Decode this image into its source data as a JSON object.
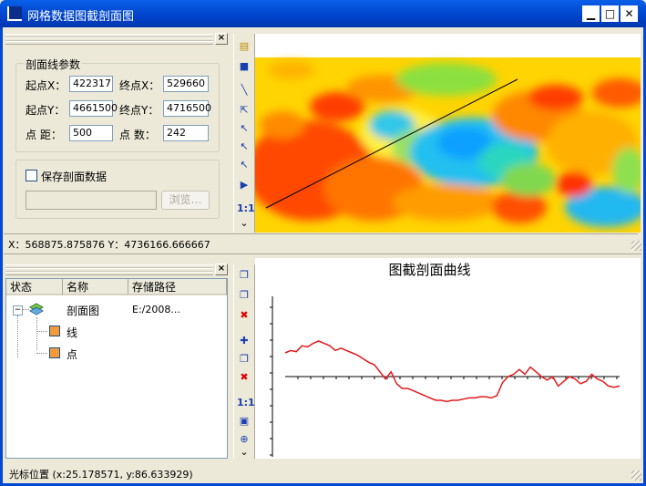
{
  "window": {
    "title": "网格数据图截剖面图"
  },
  "params": {
    "group_title": "剖面线参数",
    "start_x_label": "起点X：",
    "start_x": "422317",
    "end_x_label": "终点X：",
    "end_x": "529660",
    "start_y_label": "起点Y：",
    "start_y": "4661500",
    "end_y_label": "终点Y：",
    "end_y": "4716500",
    "spacing_label": "点 距：",
    "spacing": "500",
    "count_label": "点 数：",
    "count": "242",
    "save_label": "保存剖面数据",
    "browse_label": "浏览…"
  },
  "map_status": "X：568875.875876 Y：4736166.666667",
  "layers": {
    "headers": [
      "状态",
      "名称",
      "存储路径"
    ],
    "root": {
      "name": "剖面图",
      "path": "E:/2008..."
    },
    "children": [
      {
        "name": "线"
      },
      {
        "name": "点"
      }
    ]
  },
  "chart": {
    "title": "图截剖面曲线"
  },
  "cursor_status": "光标位置 (x:25.178571, y:86.633929)",
  "toolbar_top": {
    "ratio_label": "1:1"
  },
  "toolbar_bottom": {
    "ratio_label": "1:1"
  },
  "colors": {
    "accent": "#0047d4",
    "curve": "#e31a1c"
  },
  "chart_data": {
    "type": "line",
    "series": [
      {
        "values": [
          20,
          22,
          21,
          26,
          25,
          28,
          30,
          28,
          26,
          22,
          24,
          22,
          20,
          18,
          15,
          12,
          10,
          4,
          -2,
          4,
          -6,
          -10,
          -10,
          -12,
          -14,
          -16,
          -18,
          -20,
          -20,
          -21,
          -20,
          -20,
          -19,
          -18,
          -18,
          -17,
          -17,
          -18,
          -16,
          -5,
          0,
          2,
          6,
          2,
          8,
          4,
          0,
          -3,
          0,
          -8,
          -4,
          0,
          -2,
          -6,
          -4,
          2,
          -2,
          -4,
          -8,
          -9,
          -8
        ]
      }
    ]
  }
}
